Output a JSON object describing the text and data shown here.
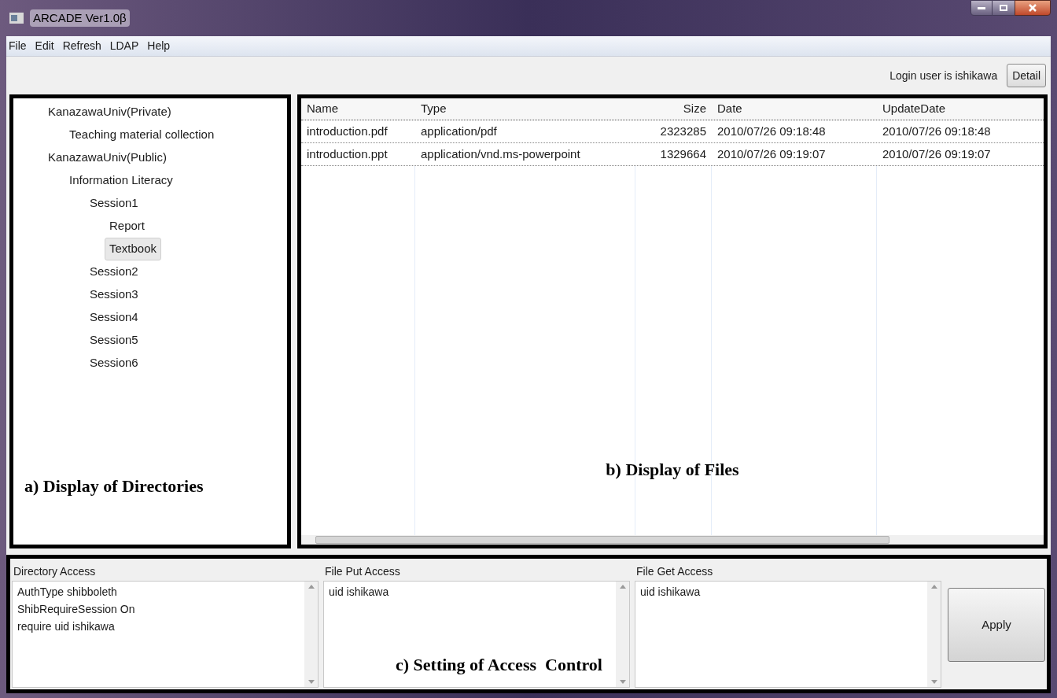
{
  "window": {
    "title": "ARCADE Ver1.0β"
  },
  "menu": [
    {
      "label": "File"
    },
    {
      "label": "Edit"
    },
    {
      "label": "Refresh"
    },
    {
      "label": "LDAP"
    },
    {
      "label": "Help"
    }
  ],
  "toolbar": {
    "login_text": "Login user is ishikawa",
    "detail_button": "Detail"
  },
  "directory_tree": [
    {
      "label": "KanazawaUniv(Private)",
      "selected": false,
      "children": [
        {
          "label": "Teaching material collection",
          "selected": false
        }
      ]
    },
    {
      "label": "KanazawaUniv(Public)",
      "selected": false,
      "children": [
        {
          "label": "Information Literacy",
          "selected": false,
          "children": [
            {
              "label": "Session1",
              "selected": false,
              "children": [
                {
                  "label": "Report",
                  "selected": false
                },
                {
                  "label": "Textbook",
                  "selected": true
                }
              ]
            },
            {
              "label": "Session2",
              "selected": false
            },
            {
              "label": "Session3",
              "selected": false
            },
            {
              "label": "Session4",
              "selected": false
            },
            {
              "label": "Session5",
              "selected": false
            },
            {
              "label": "Session6",
              "selected": false
            }
          ]
        }
      ]
    }
  ],
  "file_table": {
    "columns": [
      "Name",
      "Type",
      "Size",
      "Date",
      "UpdateDate"
    ],
    "rows": [
      [
        "introduction.pdf",
        "application/pdf",
        "2323285",
        "2010/07/26 09:18:48",
        "2010/07/26 09:18:48"
      ],
      [
        "introduction.ppt",
        "application/vnd.ms-powerpoint",
        "1329664",
        "2010/07/26 09:19:07",
        "2010/07/26 09:19:07"
      ]
    ]
  },
  "access_settings": [
    {
      "label": "Directory Access",
      "value": "AuthType shibboleth\nShibRequireSession On\nrequire uid ishikawa"
    },
    {
      "label": "File Put Access",
      "value": "uid ishikawa"
    },
    {
      "label": "File Get Access",
      "value": "uid ishikawa"
    }
  ],
  "apply_button": "Apply",
  "annotations": [
    "a) Display of Directories",
    "b) Display of Files",
    "c) Setting of Access  Control"
  ]
}
